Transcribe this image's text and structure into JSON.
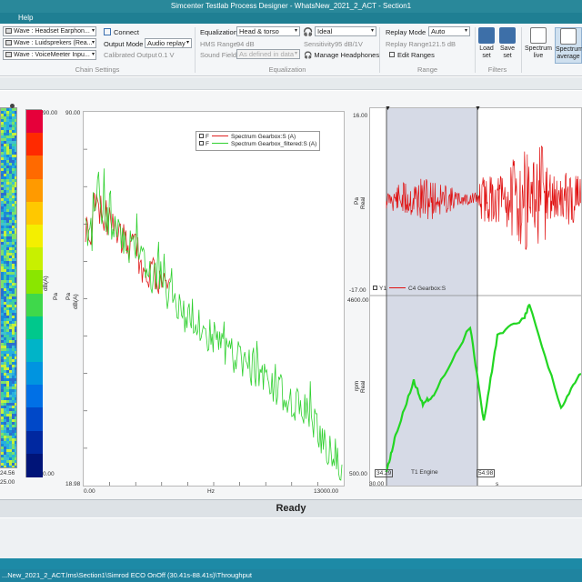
{
  "window": {
    "title": "Simcenter Testlab Process Designer - WhatsNew_2021_2_ACT - Section1",
    "menu_help": "Help"
  },
  "ribbon": {
    "chain_rows": [
      "Wave : Headset Earphon...",
      "Wave : Luidsprekers (Rea...",
      "Wave : VoiceMeeter Inpu..."
    ],
    "connect_label": "Connect",
    "output_mode_label": "Output Mode",
    "output_mode_value": "Audio replay",
    "calibrated_output_label": "Calibrated Output",
    "calibrated_output_value": "0.1 V",
    "chain_settings_caption": "Chain Settings",
    "equalization_label": "Equalization",
    "equalization_value": "Head & torso",
    "hms_range_label": "HMS Range",
    "hms_range_value": "94 dB",
    "sound_field_label": "Sound Field",
    "sound_field_value": "As defined in data",
    "headphone_value": "Ideal",
    "sensitivity_label": "Sensitivity",
    "sensitivity_value": "95 dB/1V",
    "manage_headphones_label": "Manage Headphones",
    "equalization_caption": "Equalization",
    "replay_mode_label": "Replay Mode",
    "replay_mode_value": "Auto",
    "replay_range_label": "Replay Range",
    "replay_range_value": "121.5 dB",
    "edit_ranges_label": "Edit Ranges",
    "range_caption": "Range",
    "load_set_label": "Load\nset",
    "save_set_label": "Save\nset",
    "filters_caption": "Filters",
    "spectrum_live_label": "Spectrum\nlive",
    "spectrum_average_label": "Spectrum\naverage"
  },
  "colormap": {
    "bottom_left_values": [
      "24.56",
      "25.00"
    ],
    "scale_top": "90.00",
    "scale_bottom": "0.00",
    "unit_a": "dB(A)",
    "unit_b": "Pa",
    "colors": [
      "#e6003a",
      "#ff2a00",
      "#ff6a00",
      "#ff9a00",
      "#ffc800",
      "#f4ef00",
      "#c8f000",
      "#8ae600",
      "#3fd84b",
      "#00c88c",
      "#00b4c8",
      "#0094e0",
      "#0070e6",
      "#0048c8",
      "#0028a0",
      "#001478"
    ]
  },
  "spectrum": {
    "y_top": "90.00",
    "y_bottom": "18.98",
    "y_unit_a": "dB(A)",
    "y_unit_b": "Pa",
    "x_left": "0.00",
    "x_right": "13000.00",
    "x_unit": "Hz",
    "legend": [
      {
        "flag": "F",
        "name": "Spectrum Gearbox:S (A)",
        "color": "#e02020"
      },
      {
        "flag": "F",
        "name": "Spectrum Gearbox_filtered:S (A)",
        "color": "#30d030"
      }
    ]
  },
  "time_plot": {
    "top_y_top": "16.00",
    "top_y_bottom": "-17.00",
    "top_y_unit_a": "Pa",
    "top_y_unit_b": "Real",
    "top_legend_y": "Y1",
    "top_legend_series": "C4 Gearbox:S",
    "bottom_y_top": "4600.00",
    "bottom_y_bottom": "500.00",
    "bottom_y_unit_a": "rpm",
    "bottom_y_unit_b": "Real",
    "bottom_legend_series": "T1 Engine",
    "cursor_a": "34.29",
    "cursor_b": "54.98",
    "x_left": "30.00",
    "x_unit": "s",
    "red": "#e01010",
    "green": "#22d622"
  },
  "status": {
    "ready": "Ready",
    "path": "...New_2021_2_ACT.lms\\Section1\\Simrod ECO OnOff (30.41s-88.41s)\\Throughput"
  }
}
